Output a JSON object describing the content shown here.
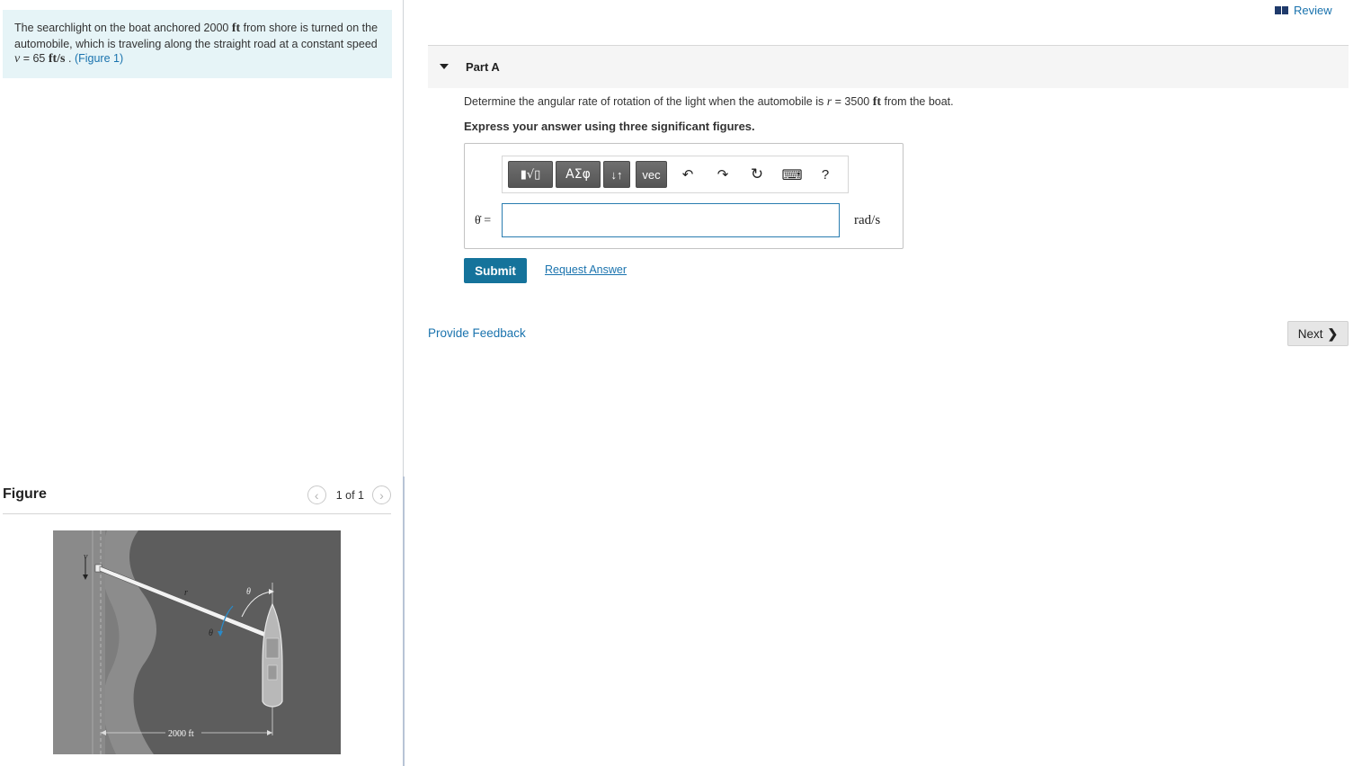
{
  "problem": {
    "text_before": "The searchlight on the boat anchored 2000 ",
    "unit_ft": "ft",
    "text_mid": " from shore is turned on the automobile, which is traveling along the straight road at a constant speed ",
    "v_symbol": "v",
    "v_eq": " = 65 ",
    "v_unit": "ft/s",
    "text_after": " . ",
    "figure_link": "(Figure 1)"
  },
  "figure": {
    "title": "Figure",
    "pager": "1 of 1",
    "labels": {
      "v": "v",
      "r": "r",
      "theta_top": "θ",
      "theta_mid": "θ",
      "distance": "2000 ft"
    }
  },
  "header": {
    "review_label": "Review"
  },
  "part": {
    "title": "Part A",
    "question_pre": "Determine the angular rate of rotation of the light when the automobile is ",
    "question_r": "r",
    "question_eq": " = 3500 ",
    "question_unit": "ft",
    "question_post": " from the boat.",
    "instruction": "Express your answer using three significant figures."
  },
  "toolbar": {
    "templates": "▮√▯",
    "greek": "ΑΣφ",
    "arrows": "↓↑",
    "vec": "vec",
    "undo": "↶",
    "redo": "↷",
    "reset": "↻",
    "keyboard": "⌨",
    "help": "?"
  },
  "answer": {
    "label": "θ̇ =",
    "value": "",
    "unit": "rad/s"
  },
  "actions": {
    "submit": "Submit",
    "request_answer": "Request Answer",
    "provide_feedback": "Provide Feedback",
    "next": "Next"
  }
}
